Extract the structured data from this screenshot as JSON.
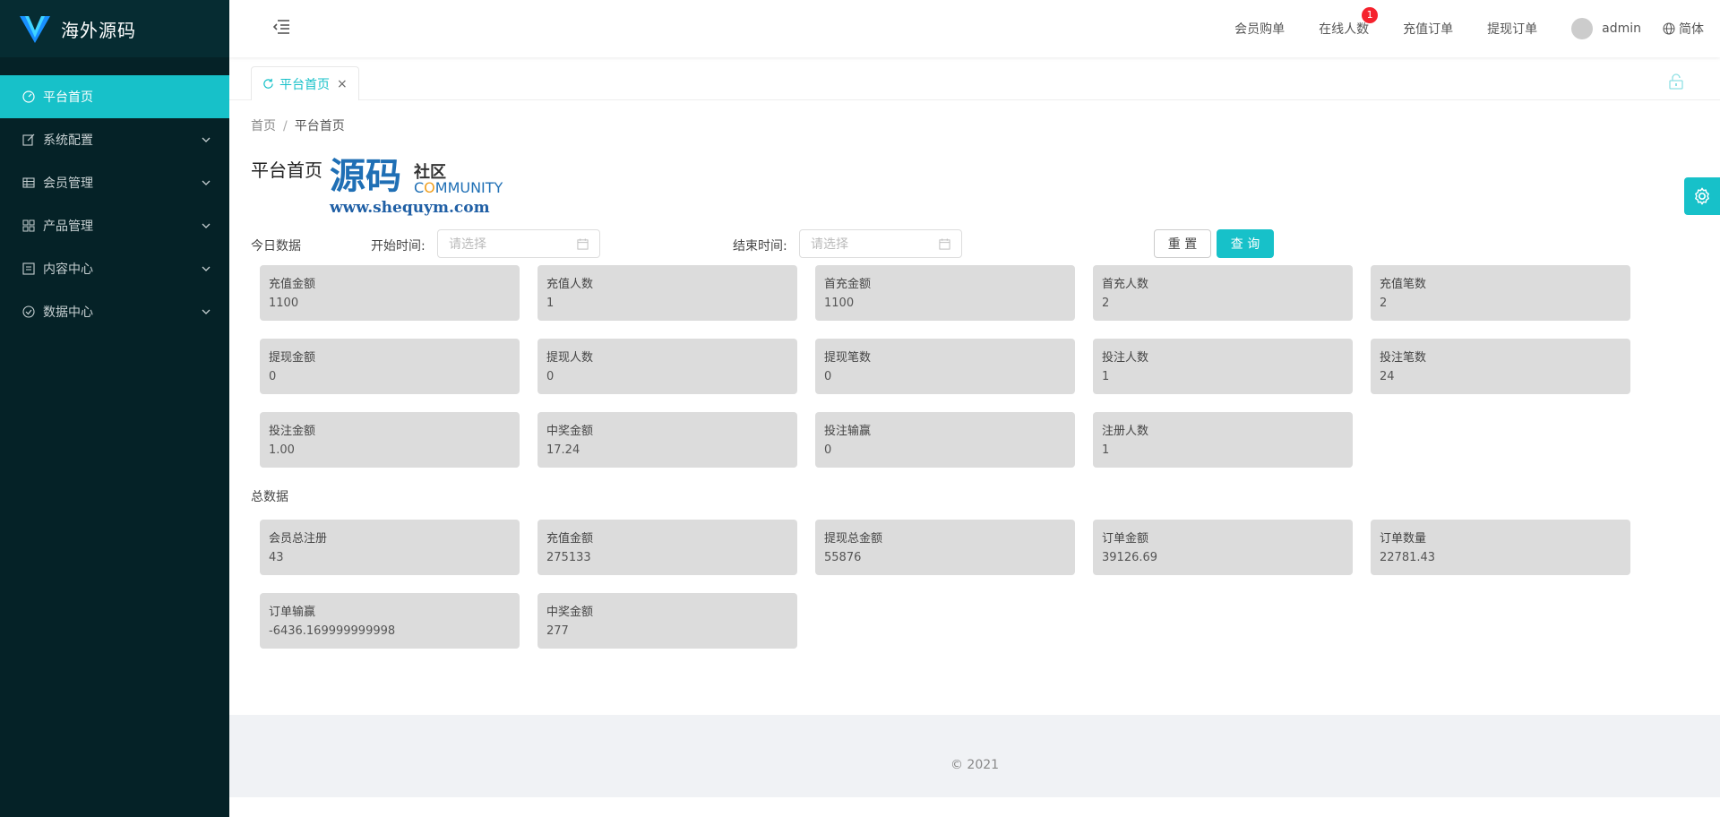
{
  "app": {
    "logo_text": "海外源码",
    "accent_color": "#17c1c9",
    "sidebar_bg": "#052227"
  },
  "sidebar": {
    "items": [
      {
        "label": "平台首页",
        "icon": "dashboard-icon",
        "active": true
      },
      {
        "label": "系统配置",
        "icon": "edit-icon",
        "expandable": true
      },
      {
        "label": "会员管理",
        "icon": "table-icon",
        "expandable": true
      },
      {
        "label": "产品管理",
        "icon": "appstore-icon",
        "expandable": true
      },
      {
        "label": "内容中心",
        "icon": "profile-icon",
        "expandable": true
      },
      {
        "label": "数据中心",
        "icon": "check-circle-icon",
        "expandable": true
      }
    ]
  },
  "header": {
    "links": [
      "会员购单",
      "在线人数",
      "充值订单",
      "提现订单"
    ],
    "online_badge": "1",
    "username": "admin",
    "language": "简体"
  },
  "tabs": {
    "active_label": "平台首页",
    "close_glyph": "×"
  },
  "breadcrumb": {
    "home": "首页",
    "separator": "/",
    "current": "平台首页"
  },
  "page": {
    "title": "平台首页"
  },
  "watermark": {
    "big": "源码",
    "sq": "社区",
    "comm_prefix": "C",
    "comm_o": "O",
    "comm_rest": "MMUNITY",
    "url": "www.shequym.com"
  },
  "filter": {
    "section_label": "今日数据",
    "start_label": "开始时间:",
    "end_label": "结束时间:",
    "start_placeholder": "请选择",
    "end_placeholder": "请选择",
    "reset_label": "重 置",
    "query_label": "查 询"
  },
  "today_stats": [
    {
      "label": "充值金额",
      "value": "1100"
    },
    {
      "label": "充值人数",
      "value": "1"
    },
    {
      "label": "首充金额",
      "value": "1100"
    },
    {
      "label": "首充人数",
      "value": "2"
    },
    {
      "label": "充值笔数",
      "value": "2"
    },
    {
      "label": "提现金额",
      "value": "0"
    },
    {
      "label": "提现人数",
      "value": "0"
    },
    {
      "label": "提现笔数",
      "value": "0"
    },
    {
      "label": "投注人数",
      "value": "1"
    },
    {
      "label": "投注笔数",
      "value": "24"
    },
    {
      "label": "投注金额",
      "value": "1.00"
    },
    {
      "label": "中奖金额",
      "value": "17.24"
    },
    {
      "label": "投注输赢",
      "value": "0"
    },
    {
      "label": "注册人数",
      "value": "1"
    }
  ],
  "total_label": "总数据",
  "total_stats": [
    {
      "label": "会员总注册",
      "value": "43"
    },
    {
      "label": "充值金额",
      "value": "275133"
    },
    {
      "label": "提现总金额",
      "value": "55876"
    },
    {
      "label": "订单金额",
      "value": "39126.69"
    },
    {
      "label": "订单数量",
      "value": "22781.43"
    },
    {
      "label": "订单输赢",
      "value": "-6436.169999999998"
    },
    {
      "label": "中奖金额",
      "value": "277"
    }
  ],
  "footer": {
    "copyright_symbol": "©",
    "year": "2021"
  }
}
